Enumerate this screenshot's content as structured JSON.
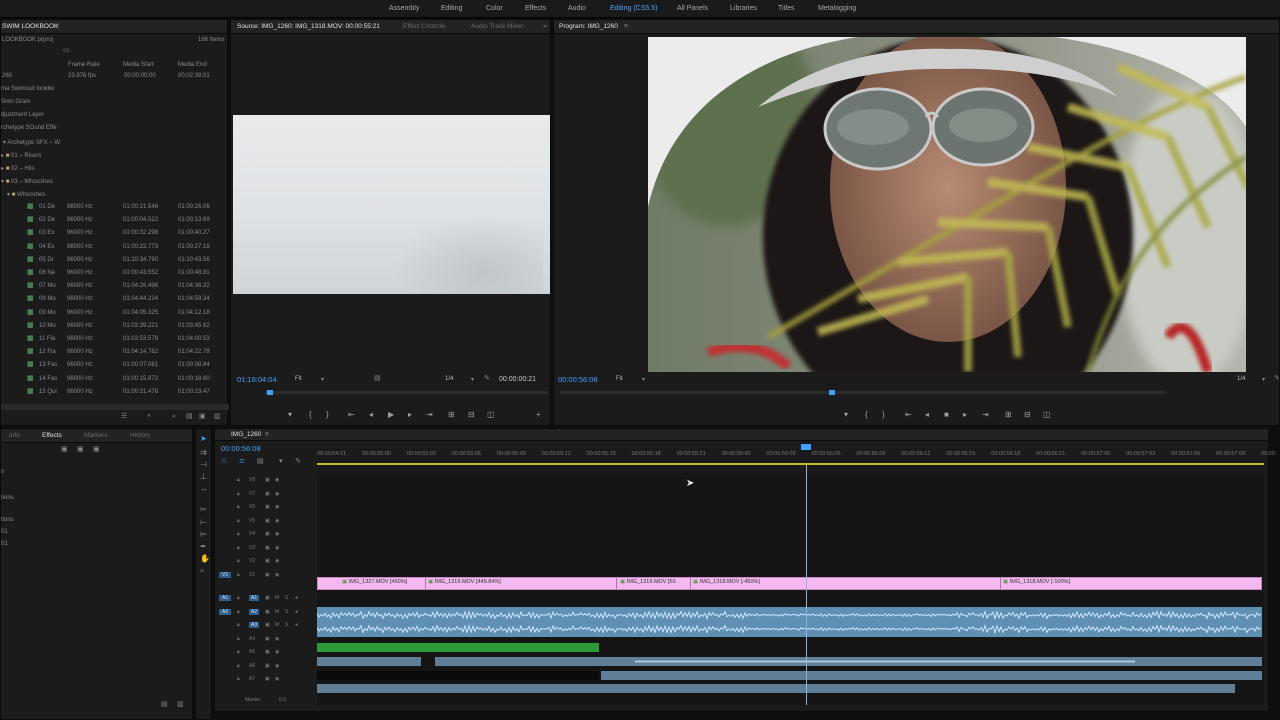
{
  "workspace_tabs": [
    "Assembly",
    "Editing",
    "Color",
    "Effects",
    "Audio",
    "Editing (CS5.5)",
    "All Panels",
    "Libraries",
    "Titles",
    "Metalogging"
  ],
  "project": {
    "title": "SWIM LOOKBOOK",
    "file": "LOOKBOOK.prproj",
    "item_count": "166 Items",
    "headers": [
      "Frame Rate",
      "Media Start",
      "Media End"
    ],
    "top_row": {
      "name": "260",
      "rate": "23.976 fps",
      "start": "00:00:00:00",
      "end": "00:02:38:01"
    },
    "items": [
      "ma Swimsuit lookbo",
      "Sren Grain",
      "djustment Layer",
      "rchetype SOund Effe",
      "Archetype SFX – W",
      "01 – Risers",
      "02 – Hits",
      "03 – Whooshes",
      "Whooshes"
    ],
    "audio_rows": [
      {
        "name": "01 De",
        "rate": "96000 Hz",
        "start": "01:00:21.546",
        "end": "01:00:26.06"
      },
      {
        "name": "02 De",
        "rate": "96000 Hz",
        "start": "01:00:04.522",
        "end": "01:00:13.69"
      },
      {
        "name": "03 Ex",
        "rate": "96000 Hz",
        "start": "01:00:32.298",
        "end": "01:00:40.27"
      },
      {
        "name": "04 Ex",
        "rate": "96000 Hz",
        "start": "01:00:22.773",
        "end": "01:00:27.19"
      },
      {
        "name": "05 Dr",
        "rate": "96000 Hz",
        "start": "01:10:34.790",
        "end": "01:10:43.56"
      },
      {
        "name": "06 Ne",
        "rate": "96000 Hz",
        "start": "01:00:43.552",
        "end": "01:00:48.81"
      },
      {
        "name": "07 Mo",
        "rate": "96000 Hz",
        "start": "01:04:26.496",
        "end": "01:04:36.22"
      },
      {
        "name": "08 Mo",
        "rate": "96000 Hz",
        "start": "01:04:44.224",
        "end": "01:04:59.34"
      },
      {
        "name": "09 Mo",
        "rate": "96000 Hz",
        "start": "01:04:05.325",
        "end": "01:04:12.18"
      },
      {
        "name": "10 Mo",
        "rate": "96000 Hz",
        "start": "01:03:39.221",
        "end": "01:03:45.62"
      },
      {
        "name": "11 Fla",
        "rate": "96000 Hz",
        "start": "01:03:53.578",
        "end": "01:04:00.53"
      },
      {
        "name": "12 Fla",
        "rate": "96000 Hz",
        "start": "01:04:14.762",
        "end": "01:04:22.78"
      },
      {
        "name": "13 Fas",
        "rate": "96000 Hz",
        "start": "01:00:07.061",
        "end": "01:00:08.84"
      },
      {
        "name": "14 Fas",
        "rate": "96000 Hz",
        "start": "01:00:15.872",
        "end": "01:00:18.60"
      },
      {
        "name": "15 Qui",
        "rate": "96000 Hz",
        "start": "01:00:21.478",
        "end": "01:00:23.47"
      }
    ]
  },
  "source": {
    "tab": "Source: IMG_1260: IMG_1318.MOV: 00:00:55:21",
    "tab2": "Effect Controls",
    "tab3": "Audio Track Mixer:",
    "timecode": "01:18:04:04",
    "fit": "Fit",
    "res": "1/4",
    "duration": "00:00:00:21"
  },
  "program": {
    "tab": "Program: IMG_1260",
    "timecode": "00:00:56:08",
    "fit": "Fit",
    "res": "1/4"
  },
  "effects_panel": {
    "tabs": [
      "Info",
      "Effects",
      "Markers",
      "History"
    ],
    "items": [
      "s",
      "tions",
      "tions",
      "01",
      "01"
    ]
  },
  "timeline": {
    "tab": "IMG_1260",
    "timecode": "00:00:56:08",
    "ruler": [
      "00:00:54:21",
      "00:00:55:00",
      "00:00:55:03",
      "00:00:55:06",
      "00:00:55:09",
      "00:00:55:12",
      "00:00:55:15",
      "00:00:55:18",
      "00:00:55:21",
      "00:00:56:00",
      "00:00:56:03",
      "00:00:56:06",
      "00:00:56:09",
      "00:00:56:12",
      "00:00:56:15",
      "00:00:56:18",
      "00:00:56:21",
      "00:00:57:00",
      "00:00:57:03",
      "00:00:57:06",
      "00:00:57:09",
      "00:00:"
    ],
    "video_tracks": [
      "V8",
      "V7",
      "V6",
      "V5",
      "V4",
      "V3",
      "V2",
      "V1"
    ],
    "audio_tracks": [
      "A1",
      "A2",
      "A3",
      "A4",
      "A5",
      "A6",
      "A7"
    ],
    "master": "Master",
    "master_val": "0.0",
    "clips": [
      "IMG_1327.MOV [450%]",
      "IMG_1319.MOV [449.84%]",
      "IMG_1319.MOV [50",
      "IMG_1318.MOV [-450%]",
      "IMG_1318.MOV [-100%]"
    ]
  },
  "colors": {
    "accent": "#3ea0ff",
    "video_clip": "#f3b8f0",
    "audio_clip": "#5f8fb3",
    "green_clip": "#2f9a3a"
  }
}
